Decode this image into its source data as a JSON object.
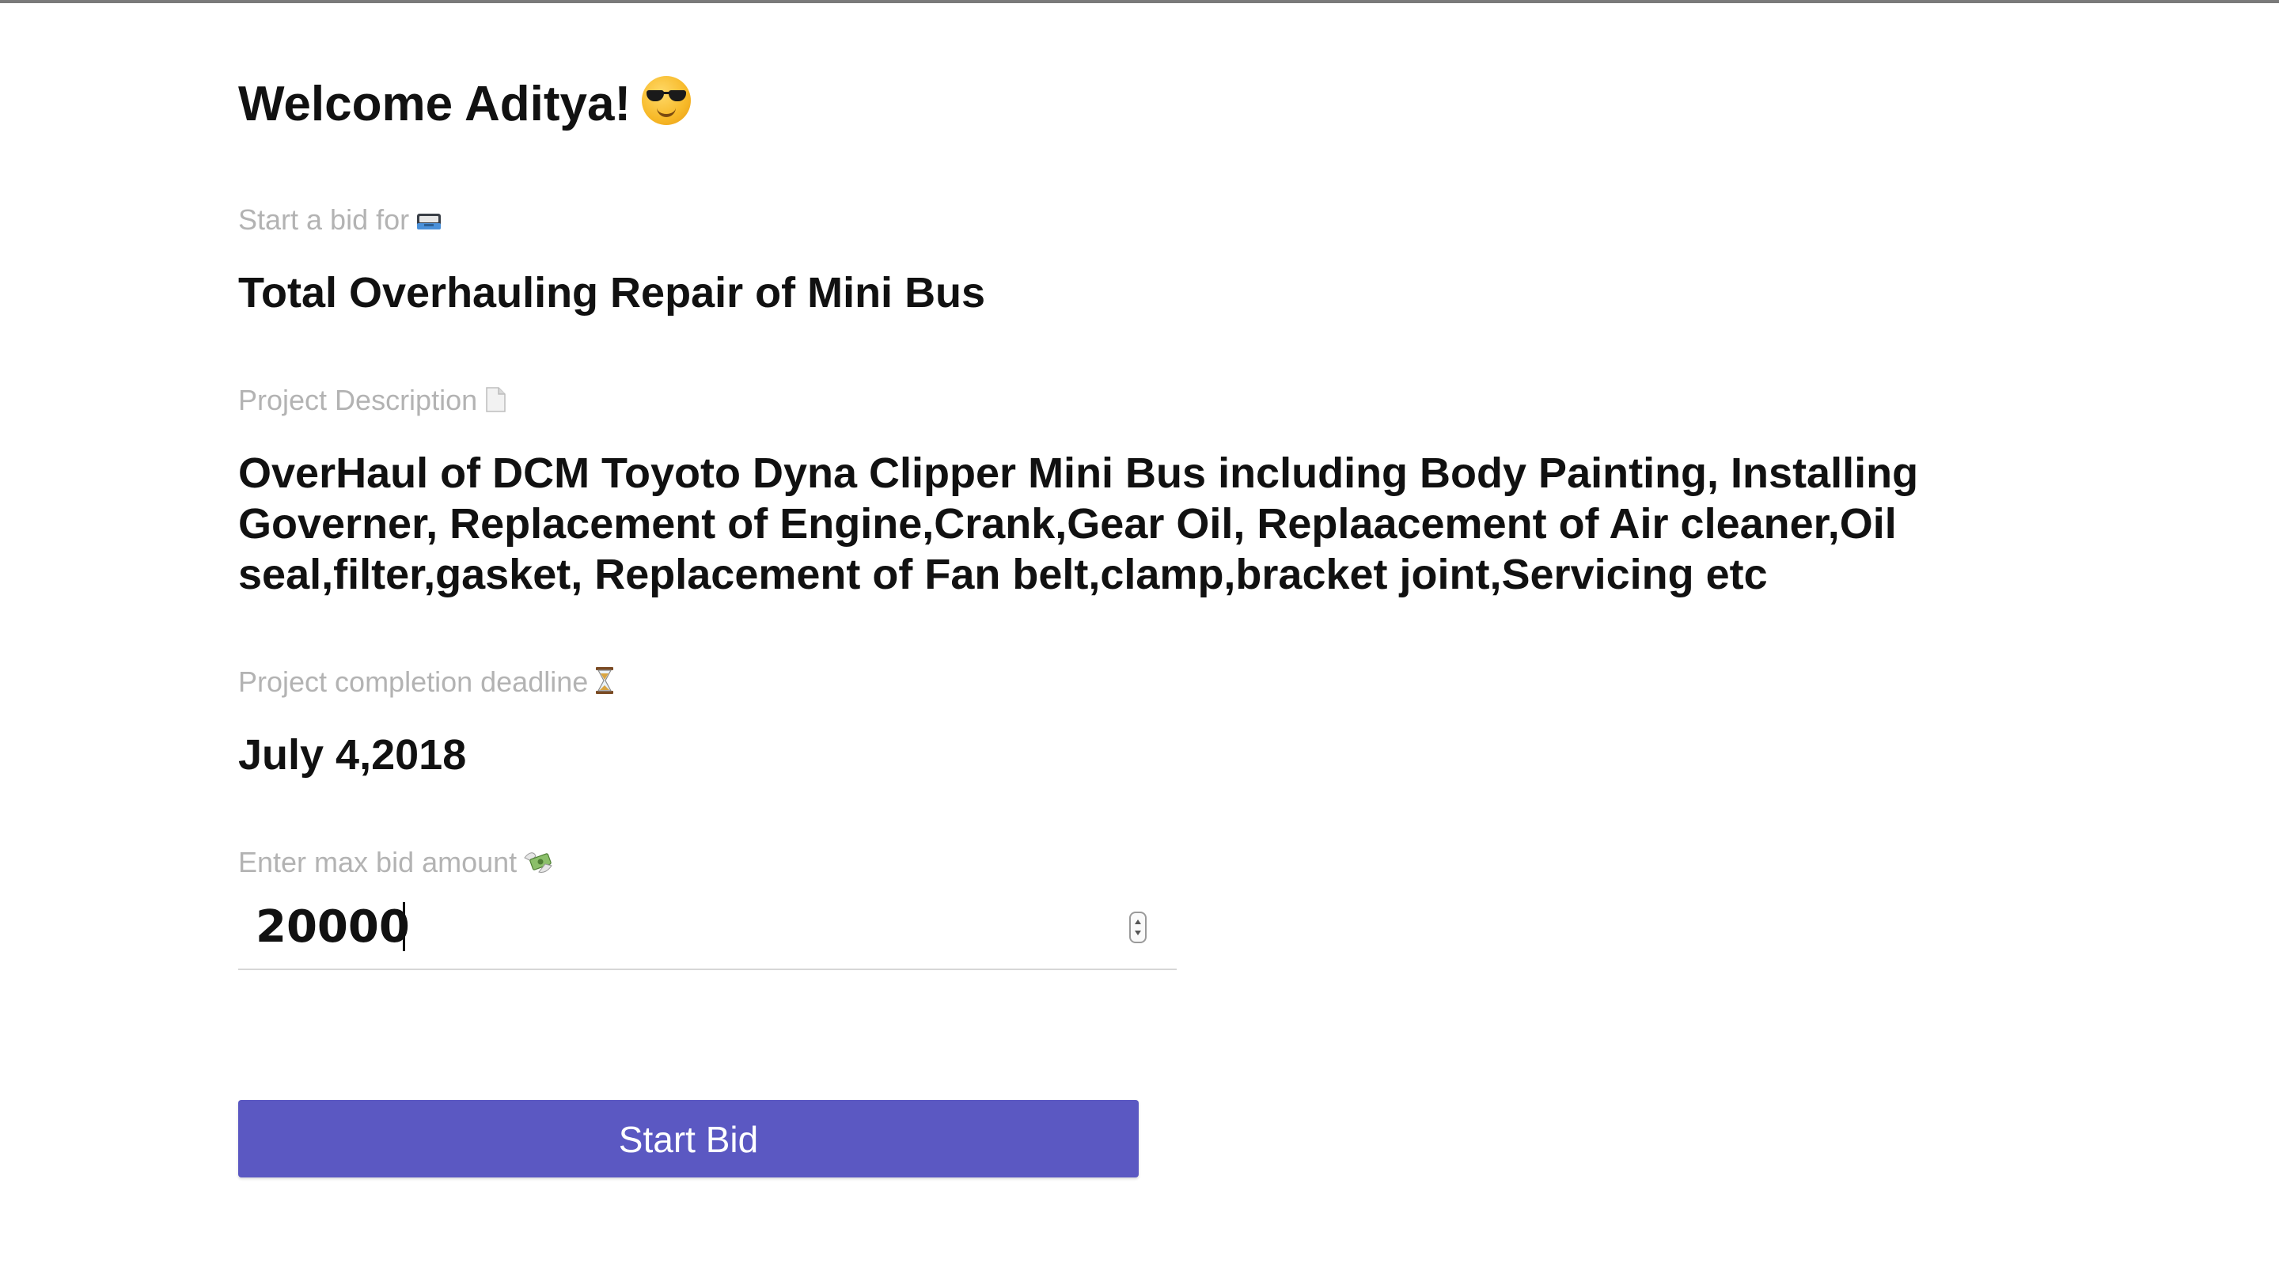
{
  "header": {
    "welcome_text": "Welcome Aditya!",
    "welcome_emoji": "smiling-face-with-sunglasses"
  },
  "bid_title": {
    "label": "Start a bid for",
    "label_icon": "inbox-tray-icon",
    "value": "Total Overhauling Repair of Mini Bus"
  },
  "description": {
    "label": "Project Description",
    "label_icon": "page-icon",
    "value": "OverHaul of DCM Toyoto Dyna Clipper Mini Bus including Body Painting, Installing Governer, Replacement of Engine,Crank,Gear Oil, Replaacement of Air cleaner,Oil seal,filter,gasket, Replacement of Fan belt,clamp,bracket joint,Servicing etc"
  },
  "deadline": {
    "label": "Project completion deadline",
    "label_icon": "hourglass-icon",
    "value": "July 4,2018"
  },
  "max_bid": {
    "label": "Enter max bid amount",
    "label_icon": "money-with-wings-icon",
    "value": "20000"
  },
  "actions": {
    "start_bid_label": "Start Bid"
  },
  "colors": {
    "button": "#5b58c2",
    "label": "#b3b3b3",
    "text": "#111111"
  }
}
